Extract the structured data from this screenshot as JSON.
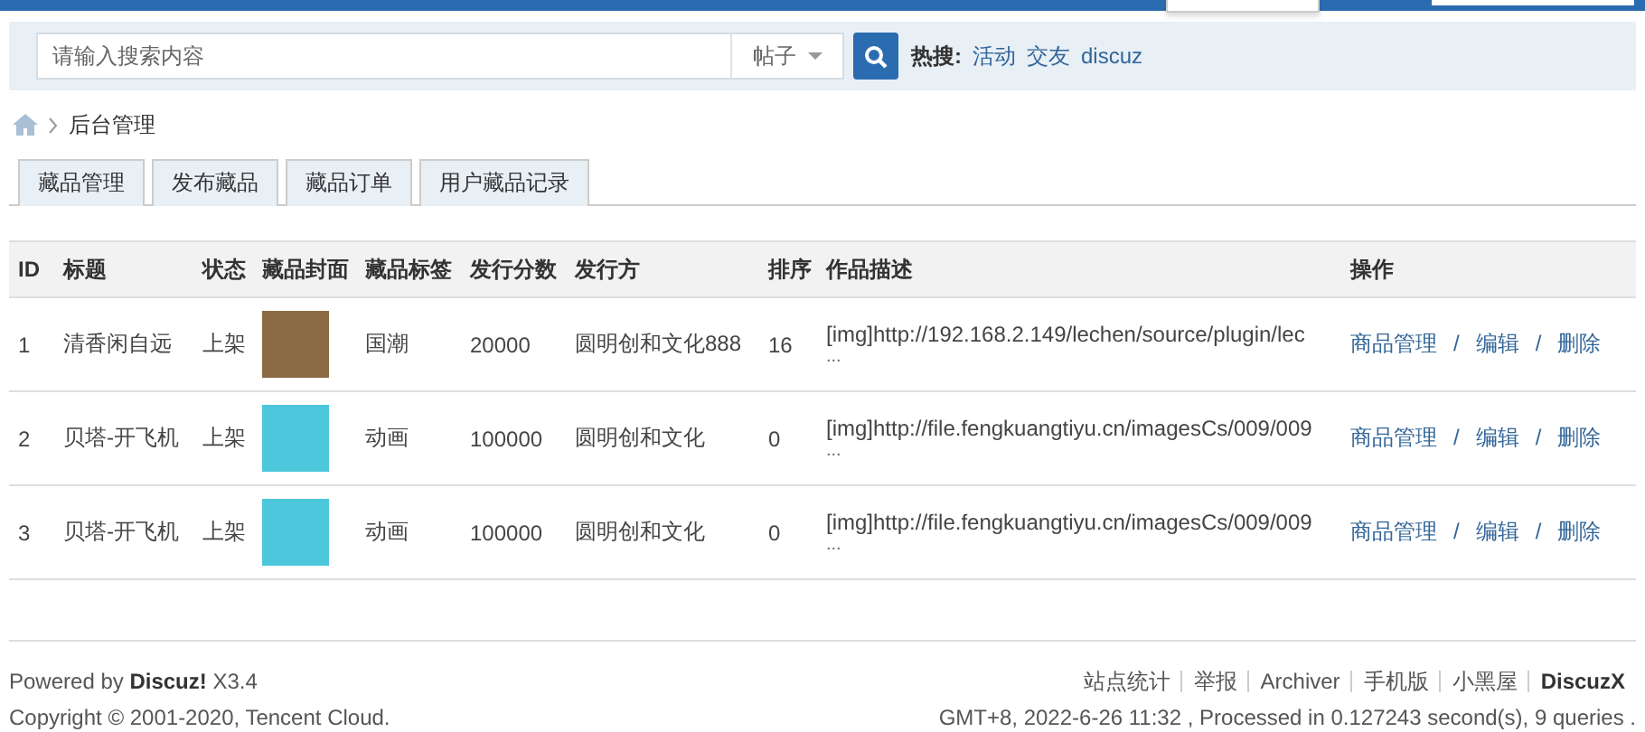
{
  "search": {
    "placeholder": "请输入搜索内容",
    "scope": "帖子",
    "hot_label": "热搜:",
    "hot_links": [
      "活动",
      "交友",
      "discuz"
    ]
  },
  "breadcrumb": [
    "后台管理"
  ],
  "tabs": [
    {
      "label": "藏品管理",
      "selected": false
    },
    {
      "label": "发布藏品",
      "selected": false
    },
    {
      "label": "藏品订单",
      "selected": false
    },
    {
      "label": "用户藏品记录",
      "selected": false
    }
  ],
  "table": {
    "columns": [
      "ID",
      "标题",
      "状态",
      "藏品封面",
      "藏品标签",
      "发行分数",
      "发行方",
      "排序",
      "作品描述",
      "操作"
    ],
    "rows": [
      {
        "id": "1",
        "title": "清香闲自远",
        "status": "上架",
        "color": "#8a6a45",
        "tag": "国潮",
        "score": "20000",
        "issuer": "圆明创和文化888",
        "order": "16",
        "description": "[img]http://192.168.2.149/lechen/source/plugin/lec",
        "more": "...",
        "actions": [
          "商品管理",
          "/",
          "编辑",
          "/",
          "删除"
        ]
      },
      {
        "id": "2",
        "title": "贝塔-开飞机",
        "status": "上架",
        "color": "#4cc7dc",
        "tag": "动画",
        "score": "100000",
        "issuer": "圆明创和文化",
        "order": "0",
        "description": "[img]http://file.fengkuangtiyu.cn/imagesCs/009/009",
        "more": "...",
        "actions": [
          "商品管理",
          "/",
          "编辑",
          "/",
          "删除"
        ]
      },
      {
        "id": "3",
        "title": "贝塔-开飞机",
        "status": "上架",
        "color": "#4cc7dc",
        "tag": "动画",
        "score": "100000",
        "issuer": "圆明创和文化",
        "order": "0",
        "description": "[img]http://file.fengkuangtiyu.cn/imagesCs/009/009",
        "more": "...",
        "actions": [
          "商品管理",
          "/",
          "编辑",
          "/",
          "删除"
        ]
      }
    ]
  },
  "footer": {
    "powered_prefix": "Powered by ",
    "powered_brand": "Discuz!",
    "powered_version": " X3.4",
    "copyright": "Copyright © 2001-2020, Tencent Cloud.",
    "links": [
      {
        "label": "站点统计",
        "bold": false
      },
      {
        "label": "举报",
        "bold": false
      },
      {
        "label": "Archiver",
        "bold": false
      },
      {
        "label": "手机版",
        "bold": false
      },
      {
        "label": "小黑屋",
        "bold": false
      },
      {
        "label": "DiscuzX",
        "bold": true
      }
    ],
    "status": "GMT+8, 2022-6-26 11:32 , Processed in 0.127243 second(s), 9 queries ."
  }
}
